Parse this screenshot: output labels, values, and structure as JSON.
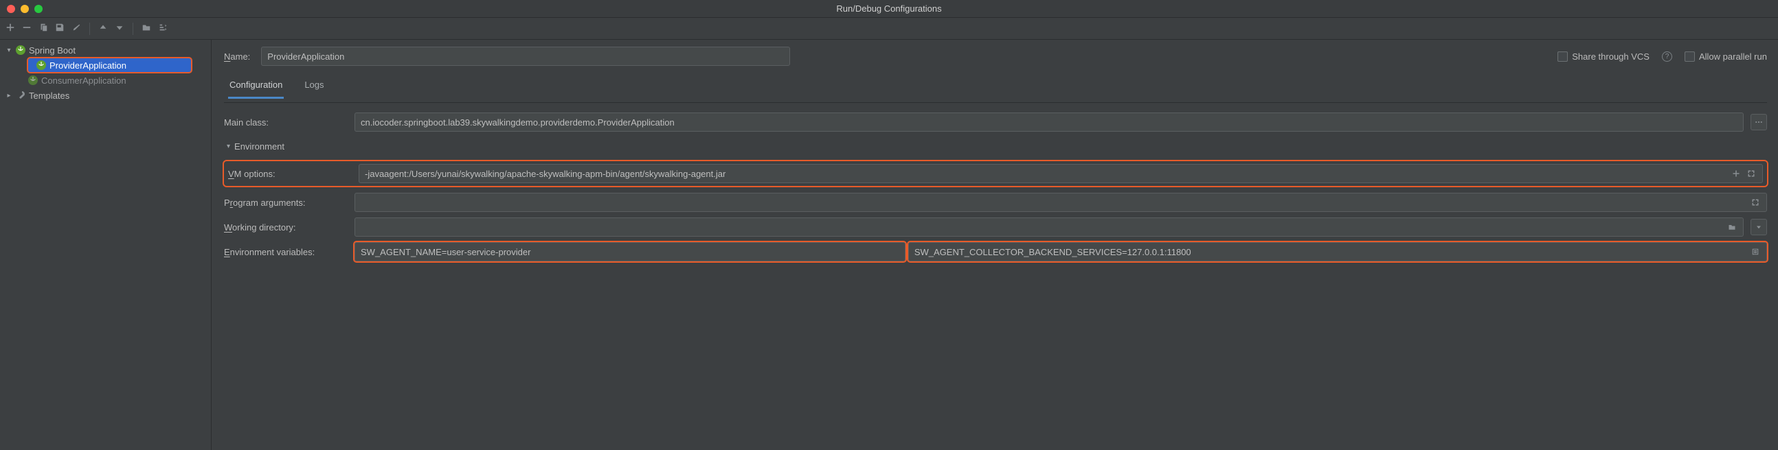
{
  "window": {
    "title": "Run/Debug Configurations"
  },
  "nameRow": {
    "label": "Name:",
    "value": "ProviderApplication"
  },
  "share": {
    "label": "Share through VCS"
  },
  "parallel": {
    "label": "Allow parallel run"
  },
  "sidebar": {
    "root": "Spring Boot",
    "items": [
      {
        "label": "ProviderApplication"
      },
      {
        "label": "ConsumerApplication"
      }
    ],
    "templates": "Templates"
  },
  "tabs": {
    "config": "Configuration",
    "logs": "Logs"
  },
  "config": {
    "mainClassLabel": "Main class:",
    "mainClass": "cn.iocoder.springboot.lab39.skywalkingdemo.providerdemo.ProviderApplication",
    "envHeader": "Environment",
    "vmLabel": "VM options:",
    "vmOptions": "-javaagent:/Users/yunai/skywalking/apache-skywalking-apm-bin/agent/skywalking-agent.jar",
    "progArgsLabel": "Program arguments:",
    "progArgs": "",
    "workDirLabel": "Working directory:",
    "workDir": "",
    "envVarsLabel": "Environment variables:",
    "envA": "SW_AGENT_NAME=user-service-provider",
    "envB": "SW_AGENT_COLLECTOR_BACKEND_SERVICES=127.0.0.1:11800"
  }
}
